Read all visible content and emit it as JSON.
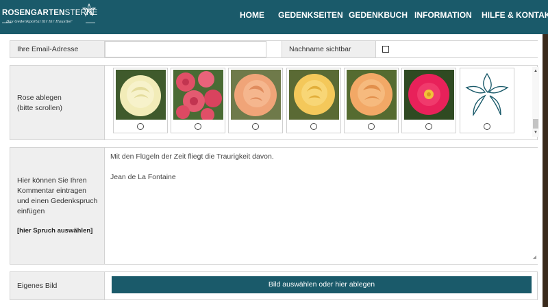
{
  "brand": {
    "name_bold": "ROSENGARTEN",
    "name_thin": "STERNE",
    "tagline": "Das Gedenkportal für Ihr Haustier"
  },
  "nav": {
    "items": [
      "HOME",
      "GEDENKSEITEN",
      "GEDENKBUCH",
      "INFORMATION",
      "HILFE & KONTAKT"
    ]
  },
  "form": {
    "email_label": "Ihre Email-Adresse",
    "email_value": "",
    "lastname_label": "Nachname sichtbar",
    "rose_label_line1": "Rose ablegen",
    "rose_label_line2": "(bitte scrollen)",
    "roses": [
      {
        "icon": "cream-rose",
        "color": "#f2ecb8"
      },
      {
        "icon": "pink-rose-cluster",
        "color": "#e04f67"
      },
      {
        "icon": "peach-rose",
        "color": "#f0a478"
      },
      {
        "icon": "yellow-rose",
        "color": "#f4c85a"
      },
      {
        "icon": "apricot-rose",
        "color": "#f2a866"
      },
      {
        "icon": "magenta-rose",
        "color": "#e8215a"
      },
      {
        "icon": "star-flower-outline",
        "color": "#1a5a6a"
      }
    ],
    "comment_label_lines": [
      "Hier können Sie Ihren",
      "Kommentar eintragen",
      "und einen Gedenkspruch",
      "einfügen"
    ],
    "quote_link": "[hier Spruch auswählen]",
    "comment_lines": [
      "Mit den Flügeln der Zeit fliegt die Traurigkeit davon.",
      "",
      "Jean de La Fontaine"
    ],
    "image_label": "Eigenes Bild",
    "upload_button": "Bild auswählen oder hier ablegen"
  },
  "colors": {
    "primary": "#1a5a6a",
    "label_bg": "#efefef",
    "border": "#d2d2d2"
  }
}
